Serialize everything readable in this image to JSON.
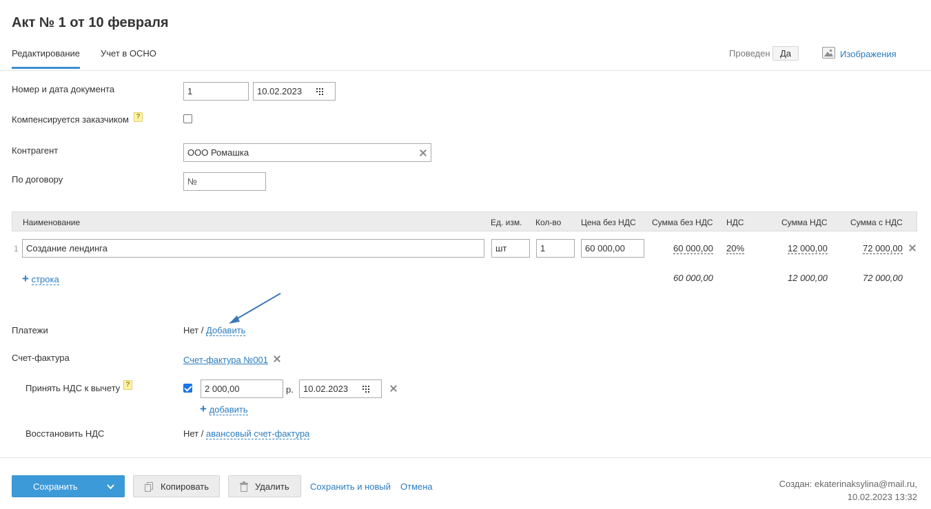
{
  "header": {
    "title": "Акт № 1 от 10 февраля",
    "tabs": [
      {
        "label": "Редактирование",
        "active": true
      },
      {
        "label": "Учет в ОСНО",
        "active": false
      }
    ],
    "posted_label": "Проведен",
    "posted_value": "Да",
    "images_link": "Изображения"
  },
  "form": {
    "doc_number_label": "Номер и дата документа",
    "doc_number": "1",
    "doc_date": "10.02.2023",
    "compensated_label": "Компенсируется заказчиком",
    "help_mark": "?",
    "compensated_checked": false,
    "counterparty_label": "Контрагент",
    "counterparty": "ООО Ромашка",
    "contract_label": "По договору",
    "contract_placeholder": "№"
  },
  "table": {
    "headers": {
      "name": "Наименование",
      "unit": "Ед. изм.",
      "qty": "Кол-во",
      "price": "Цена без НДС",
      "sum_no_vat": "Сумма без НДС",
      "vat": "НДС",
      "vat_sum": "Сумма НДС",
      "sum_with_vat": "Сумма с НДС"
    },
    "rows": [
      {
        "index": "1",
        "name": "Создание лендинга",
        "unit": "шт",
        "qty": "1",
        "price": "60 000,00",
        "sum_no_vat": "60 000,00",
        "vat": "20%",
        "vat_sum": "12 000,00",
        "sum_with_vat": "72 000,00"
      }
    ],
    "add_row_label": "строка",
    "totals": {
      "sum_no_vat": "60 000,00",
      "vat_sum": "12 000,00",
      "sum_with_vat": "72 000,00"
    }
  },
  "payments": {
    "label": "Платежи",
    "value": "Нет /",
    "add_link": "Добавить"
  },
  "invoice": {
    "label": "Счет-фактура",
    "link": "Счет-фактура №001"
  },
  "vat_deduction": {
    "label": "Принять НДС к вычету",
    "checked": true,
    "amount": "2 000,00",
    "currency": "р.",
    "date": "10.02.2023",
    "add_link": "добавить"
  },
  "vat_restore": {
    "label": "Восстановить НДС",
    "value": "Нет /",
    "link": "авансовый счет-фактура"
  },
  "footer": {
    "save_label": "Сохранить",
    "copy_label": "Копировать",
    "delete_label": "Удалить",
    "save_new_label": "Сохранить и новый",
    "cancel_label": "Отмена",
    "created_line1": "Создан: ekaterinaksylina@mail.ru,",
    "created_line2": "10.02.2023 13:32"
  },
  "colors": {
    "accent": "#3d9ad9",
    "link": "#2a7cbf",
    "arrow": "#3b78b8"
  },
  "icons": [
    "calendar-icon",
    "clear-icon",
    "help-icon",
    "image-icon",
    "copy-icon",
    "trash-icon",
    "chevron-down-icon",
    "plus-icon",
    "arrow-annotation"
  ]
}
